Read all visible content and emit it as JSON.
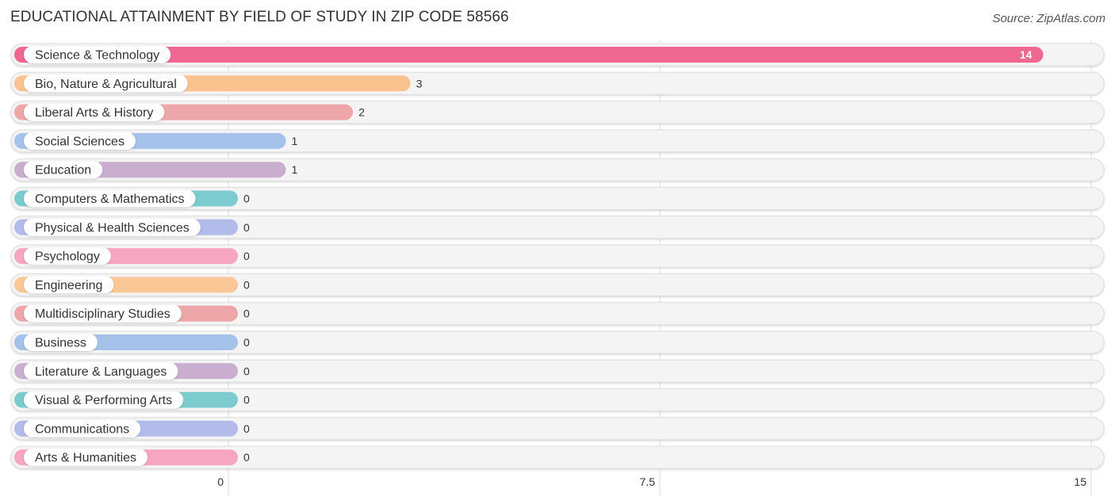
{
  "header": {
    "title": "EDUCATIONAL ATTAINMENT BY FIELD OF STUDY IN ZIP CODE 58566",
    "source": "Source: ZipAtlas.com"
  },
  "chart_data": {
    "type": "bar",
    "orientation": "horizontal",
    "title": "EDUCATIONAL ATTAINMENT BY FIELD OF STUDY IN ZIP CODE 58566",
    "xlabel": "",
    "ylabel": "",
    "xlim": [
      0,
      15
    ],
    "xticks": [
      0,
      7.5,
      15
    ],
    "xtick_labels": [
      "0",
      "7.5",
      "15"
    ],
    "grid": true,
    "categories": [
      "Science & Technology",
      "Bio, Nature & Agricultural",
      "Liberal Arts & History",
      "Social Sciences",
      "Education",
      "Computers & Mathematics",
      "Physical & Health Sciences",
      "Psychology",
      "Engineering",
      "Multidisciplinary Studies",
      "Business",
      "Literature & Languages",
      "Visual & Performing Arts",
      "Communications",
      "Arts & Humanities"
    ],
    "values": [
      14,
      3,
      2,
      1,
      1,
      0,
      0,
      0,
      0,
      0,
      0,
      0,
      0,
      0,
      0
    ],
    "value_labels": [
      "14",
      "3",
      "2",
      "1",
      "1",
      "0",
      "0",
      "0",
      "0",
      "0",
      "0",
      "0",
      "0",
      "0",
      "0"
    ],
    "colors": [
      "#f06792",
      "#f9c28f",
      "#eda7a8",
      "#a5c3ea",
      "#c9aed0",
      "#7ccbcf",
      "#b3bbea",
      "#f6a6c1",
      "#f9c896",
      "#eda7a8",
      "#a5c3ea",
      "#c9aed0",
      "#7ccbcf",
      "#b3bbea",
      "#f6a6c1"
    ]
  }
}
